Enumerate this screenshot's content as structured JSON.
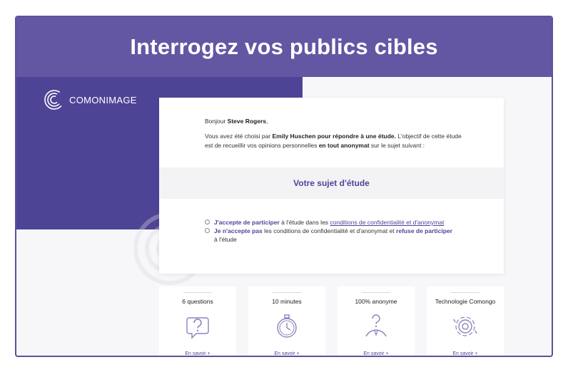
{
  "banner": {
    "title": "Interrogez vos publics cibles"
  },
  "brand": {
    "name": "COMONIMAGE"
  },
  "letter": {
    "greeting_prefix": "Bonjour ",
    "recipient": "Steve Rogers",
    "greeting_suffix": ",",
    "p1": "Vous avez été choisi par ",
    "sender": "Emily Huschen",
    "p2": " ",
    "p3": "pour répondre à une étude.",
    "p4": " L'objectif de cette étude est de recueillir vos opinions personnelles ",
    "p5": "en tout anonymat",
    "p6": " sur le sujet suivant :"
  },
  "subject": {
    "title": "Votre sujet d'étude"
  },
  "options": {
    "accept_bold": "J'accepte de participer",
    "accept_mid": " à l'étude dans les ",
    "accept_link": "conditions de confidentialité et d'anonymat",
    "refuse_bold": "Je n'accepte pas",
    "refuse_mid": " les conditions de confidentialité et d'anonymat et ",
    "refuse_bold2": "refuse de participer",
    "refuse_end": " à l'étude"
  },
  "tiles": [
    {
      "title": "6 questions",
      "more": "En savoir +",
      "icon": "question-bubble-icon"
    },
    {
      "title": "10 minutes",
      "more": "En savoir +",
      "icon": "stopwatch-icon"
    },
    {
      "title": "100% anonyme",
      "more": "En savoir +",
      "icon": "anonymous-person-icon"
    },
    {
      "title": "Technologie Comongo",
      "more": "En savoir +",
      "icon": "gear-icon"
    }
  ],
  "colors": {
    "banner": "#6357a3",
    "brand_dark": "#4e4496",
    "accent": "#4e4496"
  }
}
